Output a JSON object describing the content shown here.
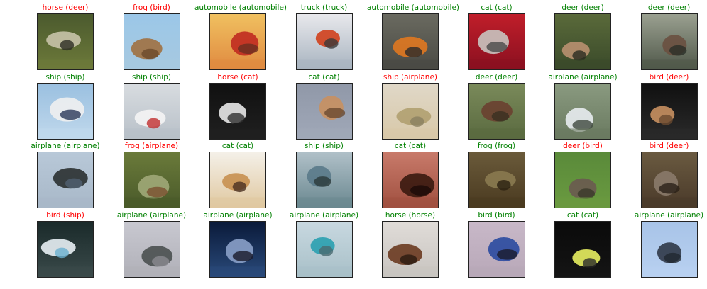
{
  "colors": {
    "correct": "#008000",
    "incorrect": "#ff0000"
  },
  "predictions": [
    {
      "label": "horse (deer)",
      "correct": false,
      "scene": [
        "#4b5a2e",
        "#6d7a3a",
        "#c8c3a8",
        "#2d2d24"
      ]
    },
    {
      "label": "frog (bird)",
      "correct": false,
      "scene": [
        "#9bc7e8",
        "#a7c9e0",
        "#a07040",
        "#6b4a2a"
      ]
    },
    {
      "label": "automobile (automobile)",
      "correct": true,
      "scene": [
        "#f0c060",
        "#e08a40",
        "#c02a20",
        "#6a3020"
      ]
    },
    {
      "label": "truck (truck)",
      "correct": true,
      "scene": [
        "#e8e8ec",
        "#a8b4c0",
        "#d0401c",
        "#3a3a3a"
      ]
    },
    {
      "label": "automobile (automobile)",
      "correct": true,
      "scene": [
        "#6a6a60",
        "#4a4a44",
        "#e07820",
        "#2a2a2a"
      ]
    },
    {
      "label": "cat (cat)",
      "correct": true,
      "scene": [
        "#c01e2a",
        "#8a1020",
        "#c8c4c0",
        "#4a4a4a"
      ]
    },
    {
      "label": "deer (deer)",
      "correct": true,
      "scene": [
        "#5a6a3a",
        "#3a4a2a",
        "#b89070",
        "#2a2a20"
      ]
    },
    {
      "label": "deer (deer)",
      "correct": true,
      "scene": [
        "#9aa090",
        "#50584a",
        "#6a5040",
        "#2a3028"
      ]
    },
    {
      "label": "ship (ship)",
      "correct": true,
      "scene": [
        "#9ac0e0",
        "#c0d8ec",
        "#f0f0f0",
        "#2a3a5a"
      ]
    },
    {
      "label": "ship (ship)",
      "correct": true,
      "scene": [
        "#d8dce0",
        "#b8c0c8",
        "#f4f4f4",
        "#c03030"
      ]
    },
    {
      "label": "horse (cat)",
      "correct": false,
      "scene": [
        "#101010",
        "#202020",
        "#e8e8e8",
        "#303030"
      ]
    },
    {
      "label": "cat (cat)",
      "correct": true,
      "scene": [
        "#9098a8",
        "#a0a8b8",
        "#c89060",
        "#6a4a30"
      ]
    },
    {
      "label": "ship (airplane)",
      "correct": false,
      "scene": [
        "#e0d8c8",
        "#d8c8a8",
        "#b0a070",
        "#8a8060"
      ]
    },
    {
      "label": "deer (deer)",
      "correct": true,
      "scene": [
        "#7a8a5a",
        "#5a6a40",
        "#6a4030",
        "#3a3020"
      ]
    },
    {
      "label": "airplane (airplane)",
      "correct": true,
      "scene": [
        "#8a9a80",
        "#6a7a60",
        "#e8ecf0",
        "#404a40"
      ]
    },
    {
      "label": "bird (deer)",
      "correct": false,
      "scene": [
        "#101010",
        "#2a2a2a",
        "#c89060",
        "#6a4a30"
      ]
    },
    {
      "label": "airplane (airplane)",
      "correct": true,
      "scene": [
        "#b8c8d8",
        "#a8b8c8",
        "#2a3030",
        "#506070"
      ]
    },
    {
      "label": "frog (airplane)",
      "correct": false,
      "scene": [
        "#6a7a3a",
        "#4a5a2a",
        "#a0a878",
        "#7a5030"
      ]
    },
    {
      "label": "cat (cat)",
      "correct": true,
      "scene": [
        "#f4f0e8",
        "#e0c8a0",
        "#c89050",
        "#4a3020"
      ]
    },
    {
      "label": "ship (ship)",
      "correct": true,
      "scene": [
        "#b0c0c8",
        "#6a8890",
        "#5a7a8a",
        "#2a3a3a"
      ]
    },
    {
      "label": "cat (cat)",
      "correct": true,
      "scene": [
        "#c87a6a",
        "#a05040",
        "#3a1a10",
        "#1a0a08"
      ]
    },
    {
      "label": "frog (frog)",
      "correct": true,
      "scene": [
        "#6a5a3a",
        "#4a3a20",
        "#8a7a50",
        "#2a2010"
      ]
    },
    {
      "label": "deer (bird)",
      "correct": false,
      "scene": [
        "#5a8a3a",
        "#6a9a40",
        "#6a5a50",
        "#3a3a2a"
      ]
    },
    {
      "label": "bird (deer)",
      "correct": false,
      "scene": [
        "#6a5a40",
        "#4a3a2a",
        "#8a7a6a",
        "#2a2018"
      ]
    },
    {
      "label": "bird (ship)",
      "correct": false,
      "scene": [
        "#1a2a2a",
        "#3a4a4a",
        "#e8f0f4",
        "#6ab0d0"
      ]
    },
    {
      "label": "airplane (airplane)",
      "correct": true,
      "scene": [
        "#c8c8d0",
        "#b0b0b8",
        "#4a5050",
        "#8a8a90"
      ]
    },
    {
      "label": "airplane (airplane)",
      "correct": true,
      "scene": [
        "#0a1a3a",
        "#2a4a7a",
        "#8aa0c8",
        "#1a1a2a"
      ]
    },
    {
      "label": "airplane (airplane)",
      "correct": true,
      "scene": [
        "#c8d8e0",
        "#a8c0c8",
        "#2aa0b0",
        "#4a6a70"
      ]
    },
    {
      "label": "horse (horse)",
      "correct": true,
      "scene": [
        "#e0dcd8",
        "#c8c4c0",
        "#6a3a20",
        "#2a1a10"
      ]
    },
    {
      "label": "bird (bird)",
      "correct": true,
      "scene": [
        "#c8b8c8",
        "#b8a8b8",
        "#2a4aa0",
        "#1a1a2a"
      ]
    },
    {
      "label": "cat (cat)",
      "correct": true,
      "scene": [
        "#0a0a0a",
        "#141414",
        "#e8f060",
        "#2a2a2a"
      ]
    },
    {
      "label": "airplane (airplane)",
      "correct": true,
      "scene": [
        "#a8c4e8",
        "#b8d0f0",
        "#303848",
        "#202830"
      ]
    }
  ]
}
